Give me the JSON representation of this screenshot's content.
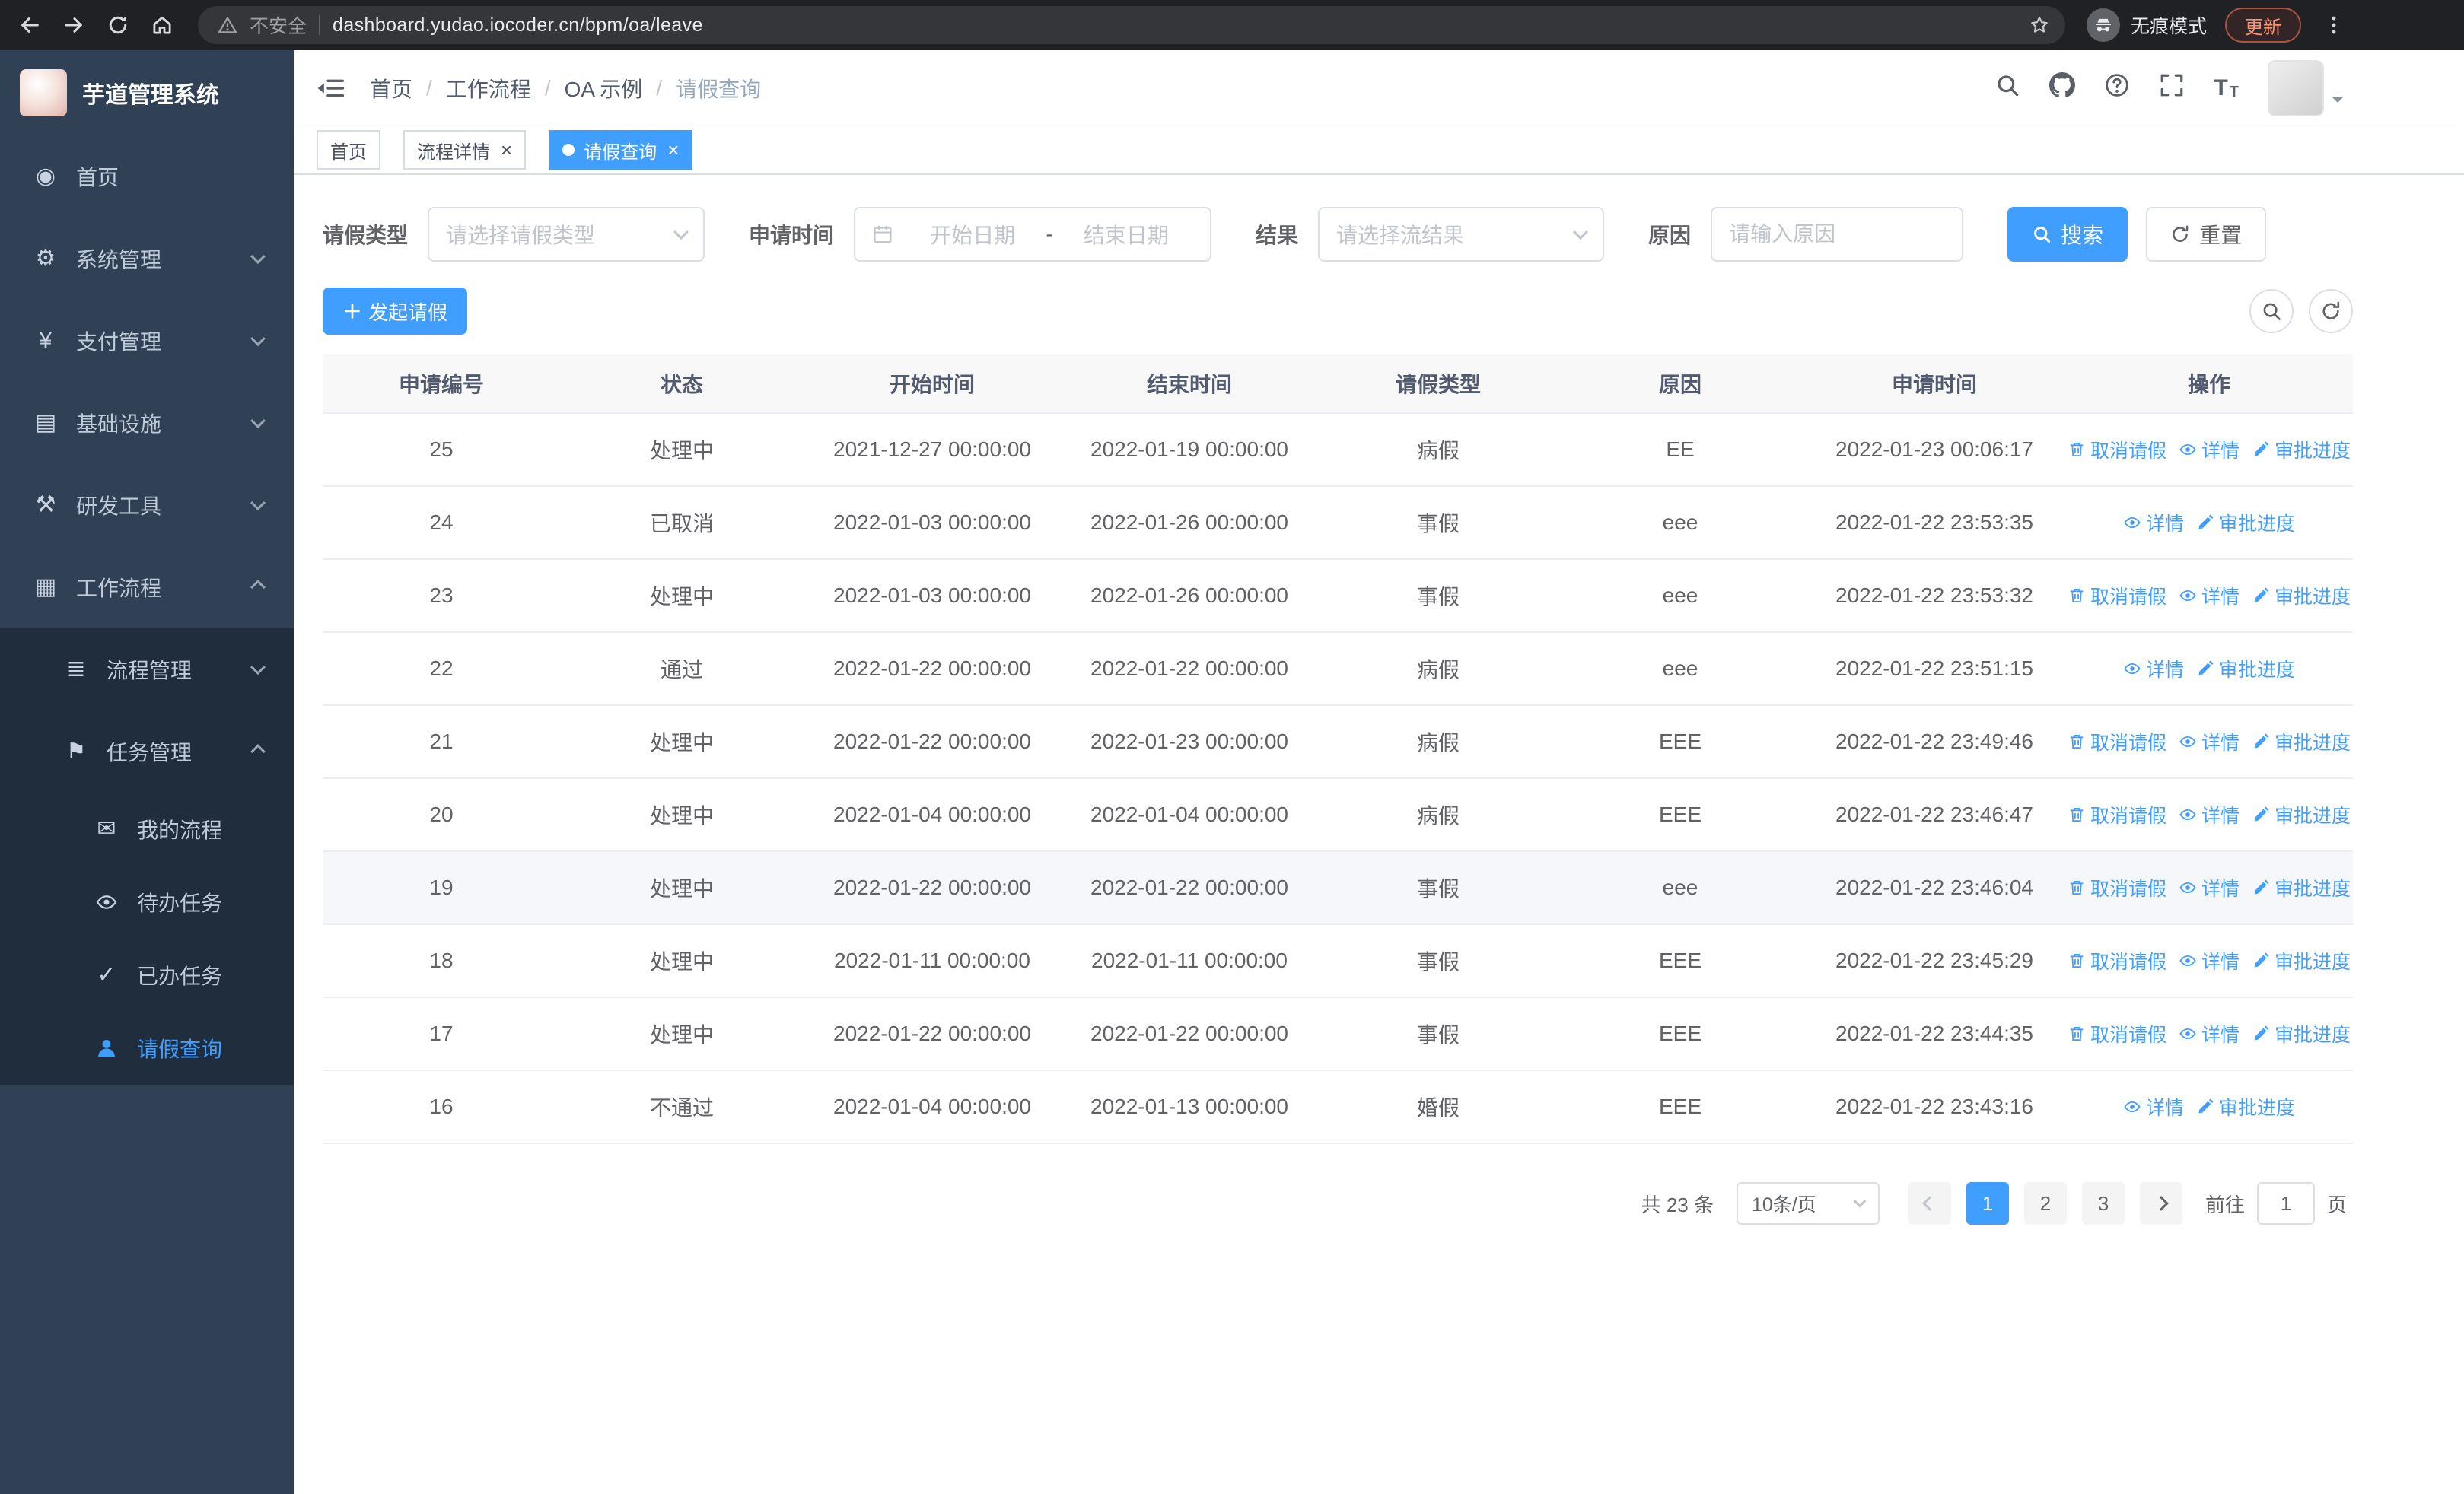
{
  "browser": {
    "security_label": "不安全",
    "url": "dashboard.yudao.iocoder.cn/bpm/oa/leave",
    "incognito_label": "无痕模式",
    "update_label": "更新"
  },
  "sidebar": {
    "logo_title": "芋道管理系统",
    "items": [
      {
        "key": "home",
        "label": "首页",
        "icon": "dashboard-icon",
        "level": 1,
        "arrow": ""
      },
      {
        "key": "system-mgmt",
        "label": "系统管理",
        "icon": "gear-icon",
        "level": 1,
        "arrow": "down"
      },
      {
        "key": "payment-mgmt",
        "label": "支付管理",
        "icon": "yen-icon",
        "level": 1,
        "arrow": "down"
      },
      {
        "key": "infrastructure",
        "label": "基础设施",
        "icon": "server-icon",
        "level": 1,
        "arrow": "down"
      },
      {
        "key": "dev-tools",
        "label": "研发工具",
        "icon": "tools-icon",
        "level": 1,
        "arrow": "down"
      },
      {
        "key": "workflow",
        "label": "工作流程",
        "icon": "workflow-icon",
        "level": 1,
        "arrow": "up"
      },
      {
        "key": "process-mgmt",
        "label": "流程管理",
        "icon": "list-icon",
        "level": 2,
        "arrow": "down"
      },
      {
        "key": "task-mgmt",
        "label": "任务管理",
        "icon": "flag-icon",
        "level": 2,
        "arrow": "up"
      },
      {
        "key": "my-process",
        "label": "我的流程",
        "icon": "message-icon",
        "level": 3,
        "arrow": ""
      },
      {
        "key": "todo-tasks",
        "label": "待办任务",
        "icon": "eye-icon",
        "level": 3,
        "arrow": ""
      },
      {
        "key": "done-tasks",
        "label": "已办任务",
        "icon": "check-icon",
        "level": 3,
        "arrow": ""
      },
      {
        "key": "leave-query",
        "label": "请假查询",
        "icon": "user-icon",
        "level": 3,
        "arrow": "",
        "active": true
      }
    ]
  },
  "navbar": {
    "breadcrumbs": [
      "首页",
      "工作流程",
      "OA 示例",
      "请假查询"
    ]
  },
  "tags": [
    {
      "key": "home",
      "label": "首页",
      "active": false,
      "closable": false
    },
    {
      "key": "process-detail",
      "label": "流程详情",
      "active": false,
      "closable": true
    },
    {
      "key": "leave-query",
      "label": "请假查询",
      "active": true,
      "closable": true
    }
  ],
  "filters": {
    "leave_type_label": "请假类型",
    "leave_type_placeholder": "请选择请假类型",
    "apply_time_label": "申请时间",
    "start_date_placeholder": "开始日期",
    "range_separator": "-",
    "end_date_placeholder": "结束日期",
    "result_label": "结果",
    "result_placeholder": "请选择流结果",
    "reason_label": "原因",
    "reason_placeholder": "请输入原因",
    "search_label": "搜索",
    "reset_label": "重置"
  },
  "toolbar": {
    "create_label": "发起请假"
  },
  "table": {
    "columns": [
      "申请编号",
      "状态",
      "开始时间",
      "结束时间",
      "请假类型",
      "原因",
      "申请时间",
      "操作"
    ],
    "rows": [
      {
        "no": "25",
        "status": "处理中",
        "start_time": "2021-12-27 00:00:00",
        "end_time": "2022-01-19 00:00:00",
        "leave_type": "病假",
        "reason": "EE",
        "apply_time": "2022-01-23 00:06:17",
        "highlight": false,
        "actions": [
          {
            "label": "取消请假",
            "icon": "trash-icon"
          },
          {
            "label": "详情",
            "icon": "eye-icon"
          },
          {
            "label": "审批进度",
            "icon": "edit-icon"
          }
        ]
      },
      {
        "no": "24",
        "status": "已取消",
        "start_time": "2022-01-03 00:00:00",
        "end_time": "2022-01-26 00:00:00",
        "leave_type": "事假",
        "reason": "eee",
        "apply_time": "2022-01-22 23:53:35",
        "highlight": false,
        "actions": [
          {
            "label": "详情",
            "icon": "eye-icon"
          },
          {
            "label": "审批进度",
            "icon": "edit-icon"
          }
        ]
      },
      {
        "no": "23",
        "status": "处理中",
        "start_time": "2022-01-03 00:00:00",
        "end_time": "2022-01-26 00:00:00",
        "leave_type": "事假",
        "reason": "eee",
        "apply_time": "2022-01-22 23:53:32",
        "highlight": false,
        "actions": [
          {
            "label": "取消请假",
            "icon": "trash-icon"
          },
          {
            "label": "详情",
            "icon": "eye-icon"
          },
          {
            "label": "审批进度",
            "icon": "edit-icon"
          }
        ]
      },
      {
        "no": "22",
        "status": "通过",
        "start_time": "2022-01-22 00:00:00",
        "end_time": "2022-01-22 00:00:00",
        "leave_type": "病假",
        "reason": "eee",
        "apply_time": "2022-01-22 23:51:15",
        "highlight": false,
        "actions": [
          {
            "label": "详情",
            "icon": "eye-icon"
          },
          {
            "label": "审批进度",
            "icon": "edit-icon"
          }
        ]
      },
      {
        "no": "21",
        "status": "处理中",
        "start_time": "2022-01-22 00:00:00",
        "end_time": "2022-01-23 00:00:00",
        "leave_type": "病假",
        "reason": "EEE",
        "apply_time": "2022-01-22 23:49:46",
        "highlight": false,
        "actions": [
          {
            "label": "取消请假",
            "icon": "trash-icon"
          },
          {
            "label": "详情",
            "icon": "eye-icon"
          },
          {
            "label": "审批进度",
            "icon": "edit-icon"
          }
        ]
      },
      {
        "no": "20",
        "status": "处理中",
        "start_time": "2022-01-04 00:00:00",
        "end_time": "2022-01-04 00:00:00",
        "leave_type": "病假",
        "reason": "EEE",
        "apply_time": "2022-01-22 23:46:47",
        "highlight": false,
        "actions": [
          {
            "label": "取消请假",
            "icon": "trash-icon"
          },
          {
            "label": "详情",
            "icon": "eye-icon"
          },
          {
            "label": "审批进度",
            "icon": "edit-icon"
          }
        ]
      },
      {
        "no": "19",
        "status": "处理中",
        "start_time": "2022-01-22 00:00:00",
        "end_time": "2022-01-22 00:00:00",
        "leave_type": "事假",
        "reason": "eee",
        "apply_time": "2022-01-22 23:46:04",
        "highlight": true,
        "actions": [
          {
            "label": "取消请假",
            "icon": "trash-icon"
          },
          {
            "label": "详情",
            "icon": "eye-icon"
          },
          {
            "label": "审批进度",
            "icon": "edit-icon"
          }
        ]
      },
      {
        "no": "18",
        "status": "处理中",
        "start_time": "2022-01-11 00:00:00",
        "end_time": "2022-01-11 00:00:00",
        "leave_type": "事假",
        "reason": "EEE",
        "apply_time": "2022-01-22 23:45:29",
        "highlight": false,
        "actions": [
          {
            "label": "取消请假",
            "icon": "trash-icon"
          },
          {
            "label": "详情",
            "icon": "eye-icon"
          },
          {
            "label": "审批进度",
            "icon": "edit-icon"
          }
        ]
      },
      {
        "no": "17",
        "status": "处理中",
        "start_time": "2022-01-22 00:00:00",
        "end_time": "2022-01-22 00:00:00",
        "leave_type": "事假",
        "reason": "EEE",
        "apply_time": "2022-01-22 23:44:35",
        "highlight": false,
        "actions": [
          {
            "label": "取消请假",
            "icon": "trash-icon"
          },
          {
            "label": "详情",
            "icon": "eye-icon"
          },
          {
            "label": "审批进度",
            "icon": "edit-icon"
          }
        ]
      },
      {
        "no": "16",
        "status": "不通过",
        "start_time": "2022-01-04 00:00:00",
        "end_time": "2022-01-13 00:00:00",
        "leave_type": "婚假",
        "reason": "EEE",
        "apply_time": "2022-01-22 23:43:16",
        "highlight": false,
        "actions": [
          {
            "label": "详情",
            "icon": "eye-icon"
          },
          {
            "label": "审批进度",
            "icon": "edit-icon"
          }
        ]
      }
    ]
  },
  "pagination": {
    "total_label": "共 23 条",
    "page_size_label": "10条/页",
    "pages": [
      "1",
      "2",
      "3"
    ],
    "active_page": "1",
    "goto_label": "前往",
    "goto_value": "1",
    "page_unit_label": "页"
  }
}
